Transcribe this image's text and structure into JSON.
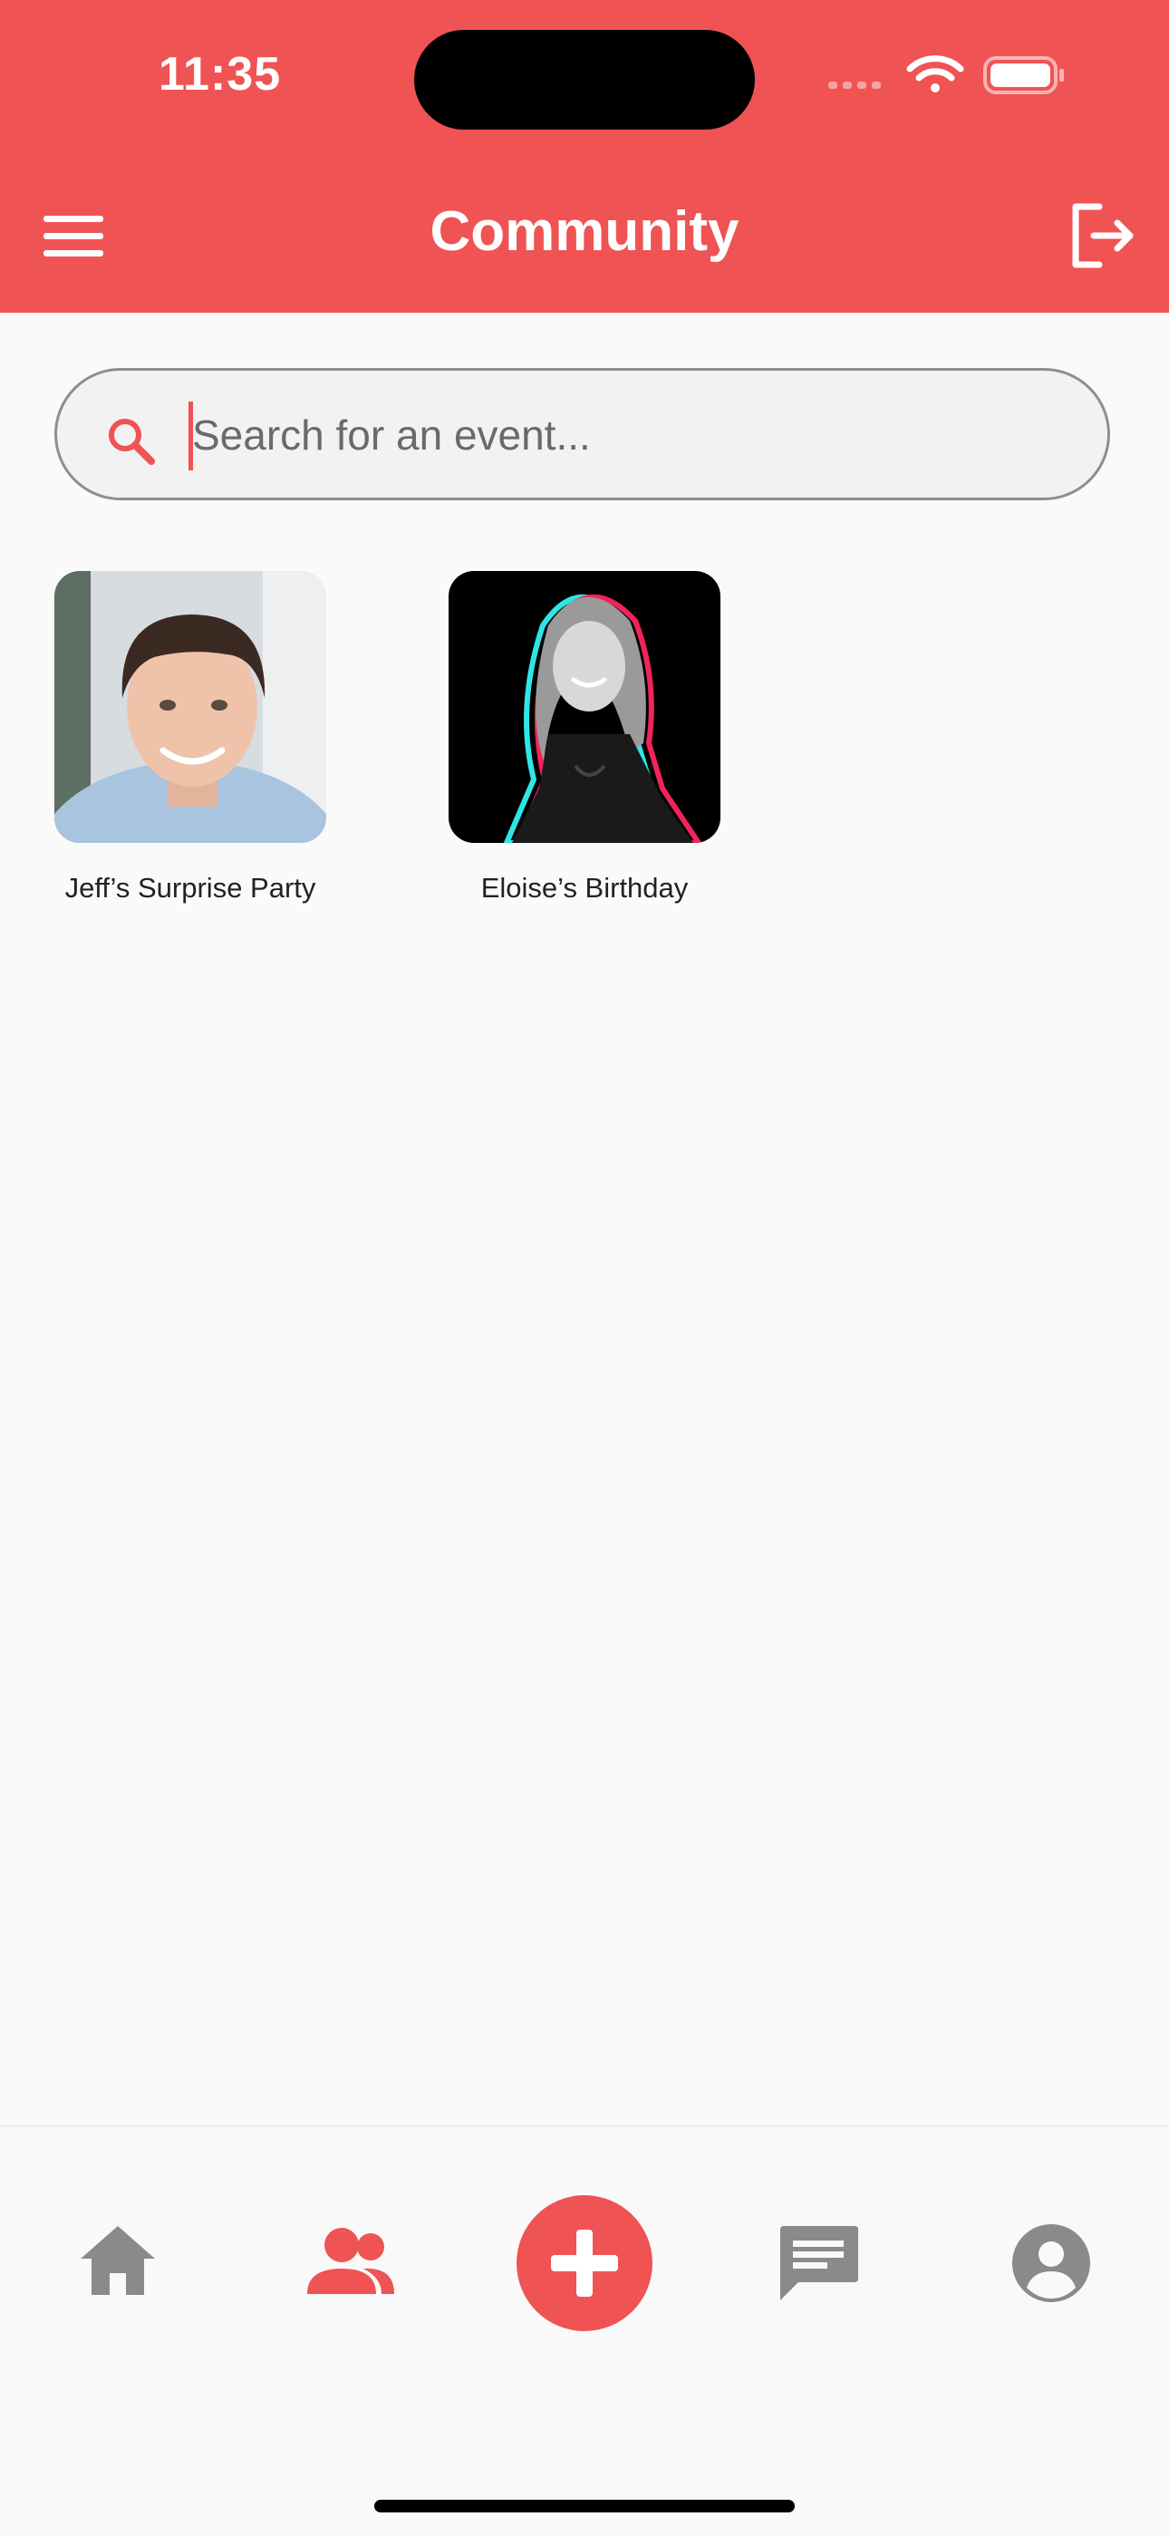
{
  "status_bar": {
    "time": "11:35"
  },
  "header": {
    "title": "Community"
  },
  "search": {
    "placeholder": "Search for an event..."
  },
  "events": [
    {
      "label": "Jeff’s Surprise Party"
    },
    {
      "label": "Eloise’s Birthday"
    }
  ],
  "colors": {
    "brand": "#F05353",
    "icon_inactive": "#8A8A8A",
    "background": "#FAFAFA"
  },
  "bottom_nav": {
    "items": [
      "home-icon",
      "community-icon",
      "add-icon",
      "chat-icon",
      "profile-icon"
    ],
    "active": "community-icon"
  }
}
